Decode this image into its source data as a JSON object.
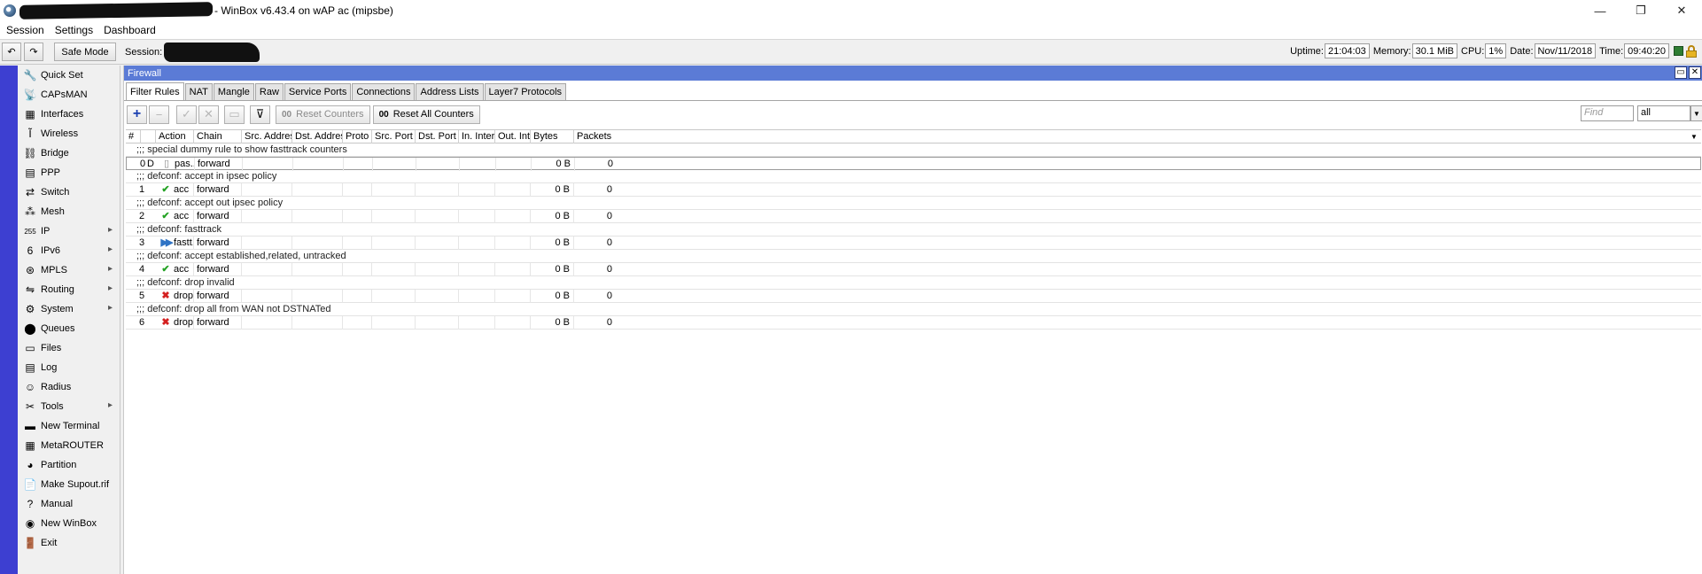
{
  "window": {
    "title": "- WinBox v6.43.4 on wAP ac (mipsbe)",
    "controls": {
      "minimize": "—",
      "restore": "❐",
      "close": "✕"
    }
  },
  "menubar": [
    "Session",
    "Settings",
    "Dashboard"
  ],
  "toolbar": {
    "undo": "↶",
    "redo": "↷",
    "safe_mode": "Safe Mode",
    "session_label": "Session:",
    "status": {
      "uptime_label": "Uptime:",
      "uptime": "21:04:03",
      "memory_label": "Memory:",
      "memory": "30.1 MiB",
      "cpu_label": "CPU:",
      "cpu": "1%",
      "date_label": "Date:",
      "date": "Nov/11/2018",
      "time_label": "Time:",
      "time": "09:40:20"
    }
  },
  "sidebar": {
    "items": [
      {
        "label": "Quick Set",
        "icon": "🔧",
        "submenu": false
      },
      {
        "label": "CAPsMAN",
        "icon": "📡",
        "submenu": false
      },
      {
        "label": "Interfaces",
        "icon": "▦",
        "submenu": false
      },
      {
        "label": "Wireless",
        "icon": "Ĩ",
        "submenu": false
      },
      {
        "label": "Bridge",
        "icon": "⛓",
        "submenu": false
      },
      {
        "label": "PPP",
        "icon": "▤",
        "submenu": false
      },
      {
        "label": "Switch",
        "icon": "⇄",
        "submenu": false
      },
      {
        "label": "Mesh",
        "icon": "⁂",
        "submenu": false
      },
      {
        "label": "IP",
        "icon": "255",
        "submenu": true
      },
      {
        "label": "IPv6",
        "icon": "6",
        "submenu": true
      },
      {
        "label": "MPLS",
        "icon": "⊛",
        "submenu": true
      },
      {
        "label": "Routing",
        "icon": "⇋",
        "submenu": true
      },
      {
        "label": "System",
        "icon": "⚙",
        "submenu": true
      },
      {
        "label": "Queues",
        "icon": "⬤",
        "submenu": false
      },
      {
        "label": "Files",
        "icon": "▭",
        "submenu": false
      },
      {
        "label": "Log",
        "icon": "▤",
        "submenu": false
      },
      {
        "label": "Radius",
        "icon": "☺",
        "submenu": false
      },
      {
        "label": "Tools",
        "icon": "✂",
        "submenu": true
      },
      {
        "label": "New Terminal",
        "icon": "▬",
        "submenu": false
      },
      {
        "label": "MetaROUTER",
        "icon": "▦",
        "submenu": false
      },
      {
        "label": "Partition",
        "icon": "◕",
        "submenu": false
      },
      {
        "label": "Make Supout.rif",
        "icon": "📄",
        "submenu": false
      },
      {
        "label": "Manual",
        "icon": "?",
        "submenu": false
      },
      {
        "label": "New WinBox",
        "icon": "◉",
        "submenu": false
      },
      {
        "label": "Exit",
        "icon": "🚪",
        "submenu": false
      }
    ]
  },
  "firewall": {
    "title": "Firewall",
    "win_buttons": {
      "maximize": "▭",
      "close": "✕"
    },
    "tabs": [
      "Filter Rules",
      "NAT",
      "Mangle",
      "Raw",
      "Service Ports",
      "Connections",
      "Address Lists",
      "Layer7 Protocols"
    ],
    "active_tab": 0,
    "toolbar": {
      "add": "+",
      "remove": "−",
      "enable": "✓",
      "disable": "✕",
      "comment": "▭",
      "filter": "⊽",
      "reset_counters": "Reset Counters",
      "reset_all_counters": "Reset All Counters",
      "counter_glyph": "00",
      "find_placeholder": "Find",
      "filter_select": "all",
      "select_arrow": "▼"
    },
    "columns": [
      "#",
      "",
      "Action",
      "Chain",
      "Src. Address",
      "Dst. Address",
      "Proto",
      "Src. Port",
      "Dst. Port",
      "In. Inter...",
      "Out. Int...",
      "Bytes",
      "Packets"
    ],
    "rows": [
      {
        "type": "comment",
        "text": ";;; special dummy rule to show fasttrack counters"
      },
      {
        "type": "rule",
        "num": "0",
        "flag": "D",
        "icon": "pass",
        "action": "pas...",
        "chain": "forward",
        "bytes": "0 B",
        "packets": "0",
        "selected": true
      },
      {
        "type": "comment",
        "text": ";;; defconf: accept in ipsec policy"
      },
      {
        "type": "rule",
        "num": "1",
        "flag": "",
        "icon": "accept",
        "action": "acc",
        "chain": "forward",
        "bytes": "0 B",
        "packets": "0"
      },
      {
        "type": "comment",
        "text": ";;; defconf: accept out ipsec policy"
      },
      {
        "type": "rule",
        "num": "2",
        "flag": "",
        "icon": "accept",
        "action": "acc",
        "chain": "forward",
        "bytes": "0 B",
        "packets": "0"
      },
      {
        "type": "comment",
        "text": ";;; defconf: fasttrack"
      },
      {
        "type": "rule",
        "num": "3",
        "flag": "",
        "icon": "fasttrack",
        "action": "fastt...",
        "chain": "forward",
        "bytes": "0 B",
        "packets": "0"
      },
      {
        "type": "comment",
        "text": ";;; defconf: accept established,related, untracked"
      },
      {
        "type": "rule",
        "num": "4",
        "flag": "",
        "icon": "accept",
        "action": "acc",
        "chain": "forward",
        "bytes": "0 B",
        "packets": "0"
      },
      {
        "type": "comment",
        "text": ";;; defconf: drop invalid"
      },
      {
        "type": "rule",
        "num": "5",
        "flag": "",
        "icon": "drop",
        "action": "drop",
        "chain": "forward",
        "bytes": "0 B",
        "packets": "0"
      },
      {
        "type": "comment",
        "text": ";;; defconf:  drop all from WAN not DSTNATed"
      },
      {
        "type": "rule",
        "num": "6",
        "flag": "",
        "icon": "drop",
        "action": "drop",
        "chain": "forward",
        "bytes": "0 B",
        "packets": "0"
      }
    ]
  },
  "colors": {
    "side_strip": "#3d3fd1",
    "fw_titlebar": "#5b7bd6",
    "accept_icon": "#25a325",
    "drop_icon": "#d42020",
    "fasttrack_icon": "#2f73c4"
  }
}
